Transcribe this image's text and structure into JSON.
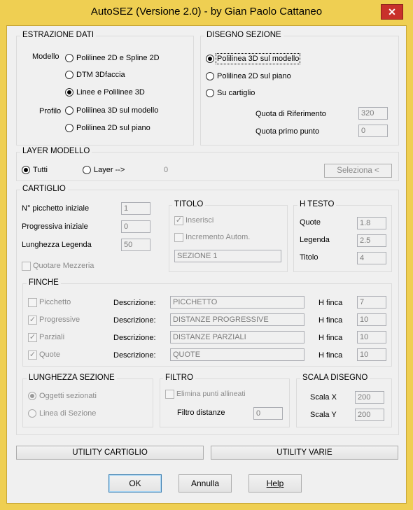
{
  "window": {
    "title": "AutoSEZ (Versione 2.0) - by Gian Paolo Cattaneo",
    "close_glyph": "✕"
  },
  "estrazione": {
    "title": "ESTRAZIONE DATI",
    "modello_label": "Modello",
    "profilo_label": "Profilo",
    "opt_polilinee2d_spline": "Polilinee 2D e Spline 2D",
    "opt_dtm": "DTM 3Dfaccia",
    "opt_linee_polilinee3d": "Linee e Polilinee 3D",
    "opt_polilinea3d_modello": "Polilinea 3D sul modello",
    "opt_polilinea2d_piano": "Polilinea 2D sul piano"
  },
  "disegno": {
    "title": "DISEGNO SEZIONE",
    "opt_polilinea3d_modello": "Polilinea 3D sul modello",
    "opt_polilinea2d_piano": "Polilinea 2D sul piano",
    "opt_su_cartiglio": "Su cartiglio",
    "quota_riferimento_label": "Quota di Riferimento",
    "quota_riferimento_value": "320",
    "quota_primo_label": "Quota primo punto",
    "quota_primo_value": "0"
  },
  "layer": {
    "title": "LAYER MODELLO",
    "opt_tutti": "Tutti",
    "opt_layer": "Layer -->",
    "layer_value": "0",
    "seleziona_label": "Seleziona <"
  },
  "cartiglio": {
    "title": "CARTIGLIO",
    "picchetto_label": "N° picchetto iniziale",
    "picchetto_value": "1",
    "progressiva_label": "Progressiva iniziale",
    "progressiva_value": "0",
    "lunghezza_label": "Lunghezza Legenda",
    "lunghezza_value": "50",
    "mezzeria_label": "Quotare Mezzeria",
    "titolo": {
      "title": "TITOLO",
      "inserisci_label": "Inserisci",
      "incremento_label": "Incremento Autom.",
      "value": "SEZIONE 1"
    },
    "htesto": {
      "title": "H TESTO",
      "quote_label": "Quote",
      "quote_value": "1.8",
      "legenda_label": "Legenda",
      "legenda_value": "2.5",
      "titolo_label": "Titolo",
      "titolo_value": "4"
    },
    "finche": {
      "title": "FINCHE",
      "desc_label": "Descrizione:",
      "hfinca_label": "H finca",
      "rows": [
        {
          "name": "Picchetto",
          "checked": false,
          "desc": "PICCHETTO",
          "h": "7"
        },
        {
          "name": "Progressive",
          "checked": true,
          "desc": "DISTANZE PROGRESSIVE",
          "h": "10"
        },
        {
          "name": "Parziali",
          "checked": true,
          "desc": "DISTANZE PARZIALI",
          "h": "10"
        },
        {
          "name": "Quote",
          "checked": true,
          "desc": "QUOTE",
          "h": "10"
        }
      ]
    },
    "lunghezza_sezione": {
      "title": "LUNGHEZZA SEZIONE",
      "opt_oggetti": "Oggetti sezionati",
      "opt_linea": "Linea di Sezione"
    },
    "filtro": {
      "title": "FILTRO",
      "elimina_label": "Elimina punti allineati",
      "distanze_label": "Filtro distanze",
      "distanze_value": "0"
    },
    "scala": {
      "title": "SCALA DISEGNO",
      "x_label": "Scala  X",
      "x_value": "200",
      "y_label": "Scala  Y",
      "y_value": "200"
    }
  },
  "buttons": {
    "utility_cartiglio": "UTILITY CARTIGLIO",
    "utility_varie": "UTILITY VARIE",
    "ok": "OK",
    "annulla": "Annulla",
    "help": "Help"
  },
  "colors": {
    "frame": "#efcf52",
    "close": "#c8312b",
    "dialog_bg": "#f0f0f0"
  }
}
